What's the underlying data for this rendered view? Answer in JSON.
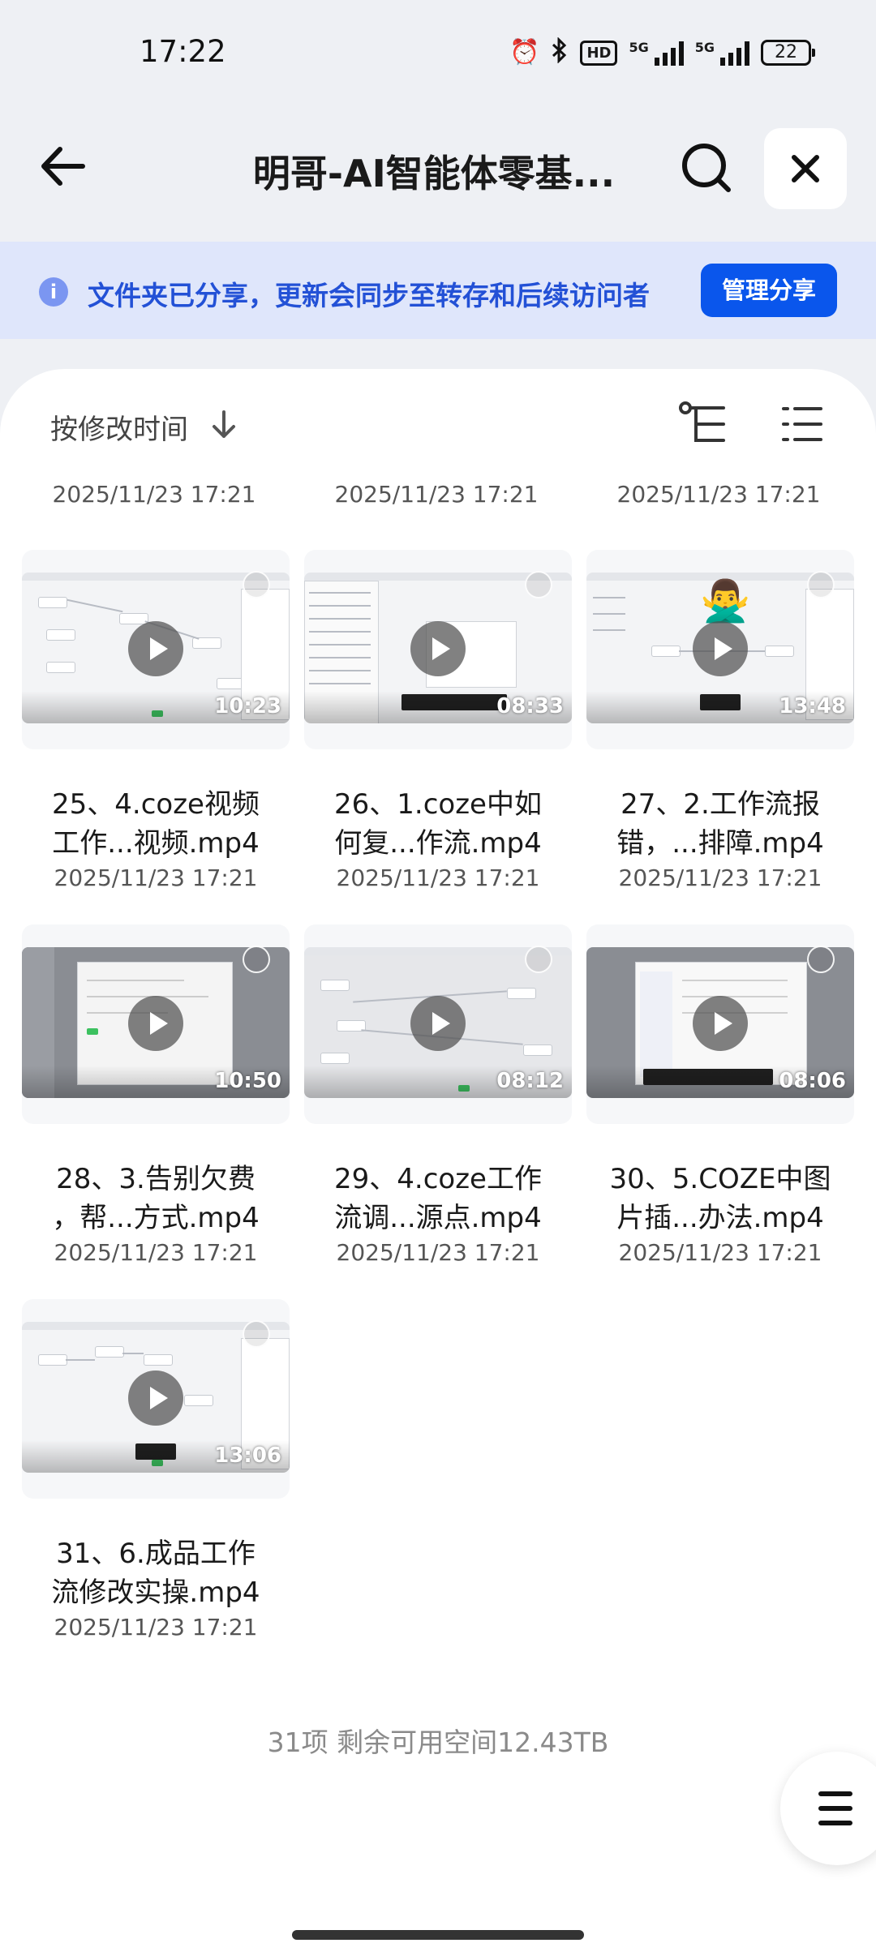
{
  "status_bar": {
    "time": "17:22",
    "icons": [
      "alarm-icon",
      "bluetooth-icon",
      "hd-voice-icon",
      "signal-5g-icon",
      "signal-5g-icon",
      "battery-icon"
    ],
    "hd_label": "HD",
    "net_labels": [
      "5G",
      "5G"
    ],
    "battery": "22"
  },
  "header": {
    "back_icon": "arrow-left-icon",
    "title": "明哥-AI智能体零基...",
    "search_icon": "search-icon",
    "close_icon": "close-icon"
  },
  "banner": {
    "icon": "info-icon",
    "icon_glyph": "i",
    "text": "文件夹已分享，更新会同步至转存和后续访问者",
    "button": "管理分享"
  },
  "toolbar": {
    "sort_label": "按修改时间",
    "sort_icon": "arrow-down-icon",
    "tree_icon": "tree-view-icon",
    "list_icon": "list-view-icon"
  },
  "prev_row_dates": [
    "2025/11/23 17:21",
    "2025/11/23 17:21",
    "2025/11/23 17:21"
  ],
  "files": [
    {
      "name_line1": "25、4.coze视频",
      "name_line2": "工作...视频.mp4",
      "date": "2025/11/23 17:21",
      "duration": "10:23"
    },
    {
      "name_line1": "26、1.coze中如",
      "name_line2": "何复...作流.mp4",
      "date": "2025/11/23 17:21",
      "duration": "08:33"
    },
    {
      "name_line1": "27、2.工作流报",
      "name_line2": "错，...排障.mp4",
      "date": "2025/11/23 17:21",
      "duration": "13:48"
    },
    {
      "name_line1": "28、3.告别欠费",
      "name_line2": "，帮...方式.mp4",
      "date": "2025/11/23 17:21",
      "duration": "10:50"
    },
    {
      "name_line1": "29、4.coze工作",
      "name_line2": "流调...源点.mp4",
      "date": "2025/11/23 17:21",
      "duration": "08:12"
    },
    {
      "name_line1": "30、5.COZE中图",
      "name_line2": "片插...办法.mp4",
      "date": "2025/11/23 17:21",
      "duration": "08:06"
    },
    {
      "name_line1": "31、6.成品工作",
      "name_line2": "流修改实操.mp4",
      "date": "2025/11/23 17:21",
      "duration": "13:06"
    }
  ],
  "footer": {
    "info": "31项 剩余可用空间12.43TB",
    "menu_icon": "menu-icon"
  },
  "colors": {
    "accent": "#0a56ec",
    "banner_bg": "#dfe6fb",
    "banner_text": "#2351d6",
    "page_bg": "#eef0f4"
  }
}
